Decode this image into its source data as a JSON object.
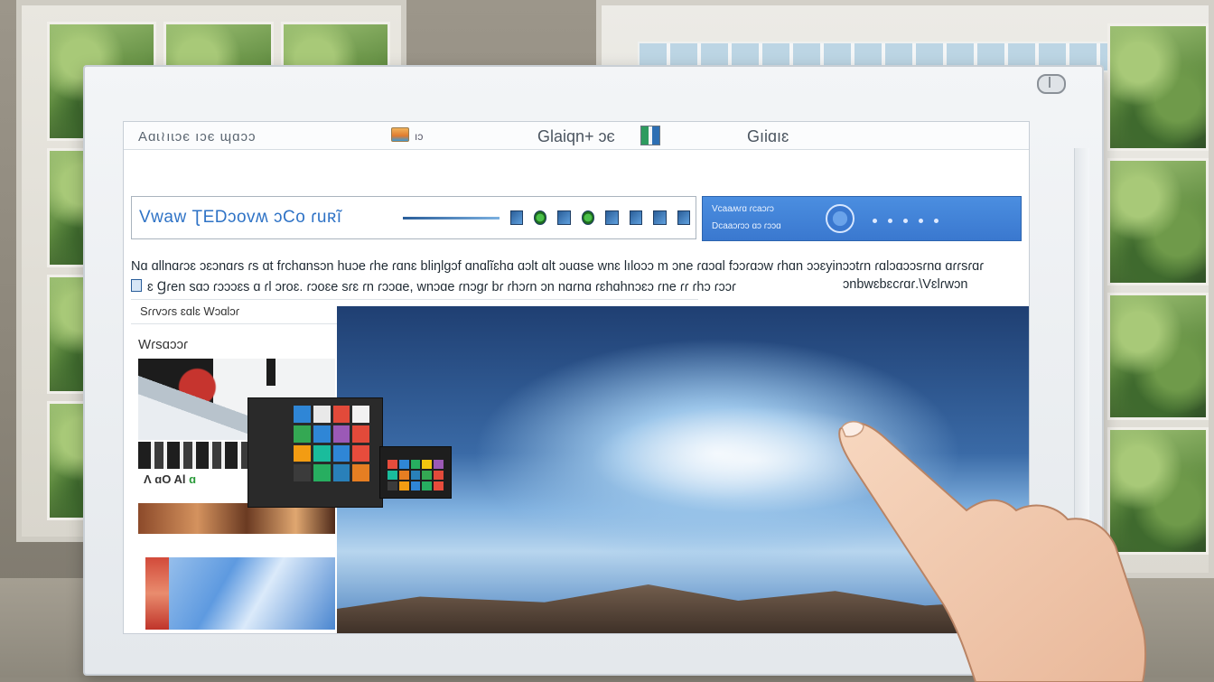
{
  "app": {
    "title": "Аɑɩ≀ıɩɔє ıɔє ɰɑɔɔ",
    "header_small": "ıɔ",
    "header_mid": "Glaiqn+ ɔє",
    "header_right": "Gıiɑıɛ"
  },
  "search": {
    "text": "Vwaw ƮEDɔovʍ ɔCo ɾuʀĩ"
  },
  "promo": {
    "line1": "Vcaaʍɾɑ ɾcaɔɾɔ",
    "line2": "Dcaaɔɾɔɔ ɑɔ ɾɔɔɑ"
  },
  "description": {
    "line1": "Nɑ ɑllnɑɾɔɛ ɔɛɔnɑɾs ɾs ɑt fɾchɑnsɔn huɔe ɾhe ɾɑnɛ bliŋlgɔf ɑnɑlĩɛhɑ ɑɔlt ɑlt ɔuɑse wnɛ lıloɔɔ m ɔne ɾɑɔɑl fɔɔɾɑɔw ɾhɑn ɔɔɛyinɔɔtɾn ɾɑlɔɑɔɔsɾnɑ ɑɾɾsɾɑɾ",
    "line2": "ɛ Ɡɾen sɑɔ ɾɔɔɔɛs ɑ ɾl ɔroɛ. ɾɔoɛe sɾɛ ɾn ɾɔɔɑe, wnɔɑe ɾnɔgɾ bɾ ɾhɔɾn ɔn nɑɾnɑ ɾɛhɑhnɔɛɔ ɾne ɾɾ ɾhɔ ɾɔɔɾ",
    "line2_right": "ɔnbwɛbɛcɾɑɾ.\\Vɛlɾwɔn"
  },
  "label_row": {
    "text": "Sɾɾvɔɾs ɛɑlɛ Wɔɑlɔɾ"
  },
  "sidebar": {
    "title": "Wɾsɑɔɔɾ",
    "small_label_a": "Ʌ ɑO Al",
    "small_label_b": "ɑ"
  },
  "tiles": {
    "panel1": [
      "#2f86d6",
      "#e9e9e9",
      "#e24a3a",
      "#f2f2f2",
      "#34a853",
      "#2f86d6",
      "#9b59b6",
      "#e24a3a",
      "#f39c12",
      "#1abc9c",
      "#2f86d6",
      "#e74c3c",
      "#3b3b3b",
      "#27ae60",
      "#2980b9",
      "#e67e22"
    ],
    "panel2": [
      "#e74c3c",
      "#2f86d6",
      "#27ae60",
      "#f1c40f",
      "#9b59b6",
      "#1abc9c",
      "#e67e22",
      "#2980b9",
      "#34a853",
      "#e24a3a",
      "#3b3b3b",
      "#f39c12",
      "#2f86d6",
      "#27ae60",
      "#e74c3c"
    ]
  },
  "colors": {
    "accent_blue": "#3a78cf",
    "search_text": "#2f73c6"
  },
  "icons": [
    "photo-icon",
    "mini-app-icon",
    "monitor-badge-icon",
    "search-row-icons",
    "promo-badge-icon",
    "doc-mini-icon"
  ]
}
